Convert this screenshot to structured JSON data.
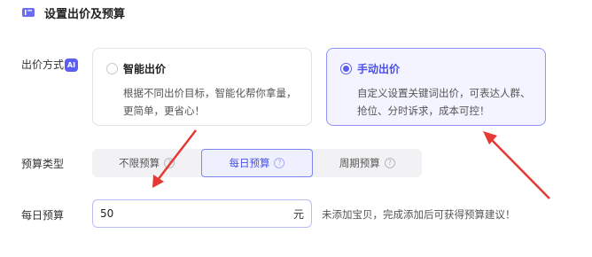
{
  "header": {
    "icon": "coupon-icon",
    "title": "设置出价及预算"
  },
  "bid": {
    "label": "出价方式",
    "ai_badge": "AI",
    "options": [
      {
        "title": "智能出价",
        "desc_line1": "根据不同出价目标，智能化帮你拿量，",
        "desc_line2": "更简单，更省心！",
        "selected": false
      },
      {
        "title": "手动出价",
        "desc_line1": "自定义设置关键词出价，可表达人群、",
        "desc_line2": "抢位、分时诉求，成本可控！",
        "selected": true
      }
    ]
  },
  "budget_type": {
    "label": "预算类型",
    "options": [
      {
        "label": "不限预算",
        "active": false
      },
      {
        "label": "每日预算",
        "active": true
      },
      {
        "label": "周期预算",
        "active": false
      }
    ]
  },
  "daily_budget": {
    "label": "每日预算",
    "value": "50",
    "unit": "元",
    "hint": "未添加宝贝，完成添加后可获得预算建议！"
  },
  "colors": {
    "accent": "#5b5ef0",
    "annotation_arrow": "#e53935"
  }
}
